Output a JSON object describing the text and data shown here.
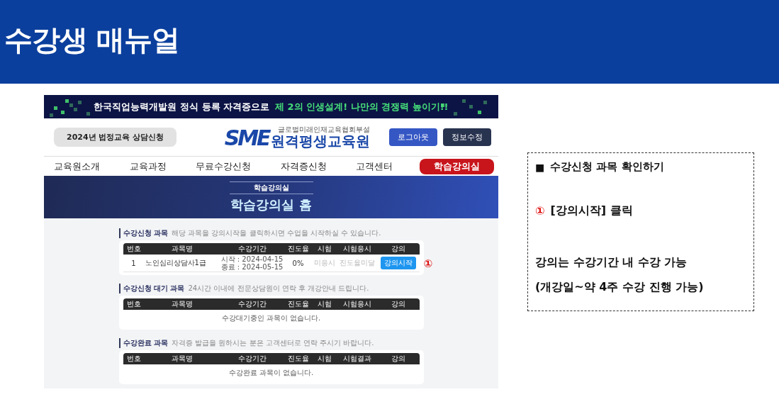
{
  "slide": {
    "title": "수강생 매뉴얼"
  },
  "site": {
    "banner": {
      "text": "한국직업능력개발원 정식 등록 자격증으로",
      "highlight": "제 2의 인생설계! 나만의 경쟁력 높이기!!"
    },
    "consult_button": "2024년 법정교육 상담신청",
    "logo": {
      "mark": "SME",
      "subtitle": "글로벌미래인재교육협회부설",
      "name": "원격평생교육원"
    },
    "header_buttons": [
      {
        "label": "로그아웃",
        "kind": "primary"
      },
      {
        "label": "정보수정",
        "kind": "dark"
      }
    ],
    "nav": [
      {
        "label": "교육원소개",
        "selected": false
      },
      {
        "label": "교육과정",
        "selected": false
      },
      {
        "label": "무료수강신청",
        "selected": false
      },
      {
        "label": "자격증신청",
        "selected": false
      },
      {
        "label": "고객센터",
        "selected": false
      },
      {
        "label": "학습강의실",
        "selected": true
      }
    ],
    "hero": {
      "breadcrumb": "학습강의실",
      "title": "학습강의실 홈"
    },
    "sections": [
      {
        "title": "수강신청 과목",
        "note": "해당 과목을 강의시작을 클릭하시면 수업을 시작하실 수 있습니다.",
        "columns": [
          "번호",
          "과목명",
          "수강기간",
          "진도율",
          "시험",
          "시험응시",
          "강의"
        ],
        "rows": [
          {
            "number": "1",
            "course": "노인심리상담사1급",
            "period": [
              "시작 : 2024-04-15",
              "종료 : 2024-05-15"
            ],
            "progress": "0%",
            "exam": "미응시",
            "exam_status": "진도율미달",
            "action": "강의시작",
            "marker": "①"
          }
        ]
      },
      {
        "title": "수강신청 대기 과목",
        "note": "24시간 이내에 전문상담원이 연락 후 개강안내 드립니다.",
        "columns": [
          "번호",
          "과목명",
          "수강기간",
          "진도율",
          "시험",
          "시험응시",
          "강의"
        ],
        "empty_message": "수강대기중인 과목이 없습니다."
      },
      {
        "title": "수강완료 과목",
        "note": "자격증 발급을 원하시는 분은 고객센터로 연락 주시기 바랍니다.",
        "columns": [
          "번호",
          "과목명",
          "수강기간",
          "진도율",
          "시험",
          "시험결과",
          "강의"
        ],
        "empty_message": "수강완료 과목이 없습니다."
      }
    ]
  },
  "callout": {
    "bullet": "■",
    "heading": "수강신청 과목 확인하기",
    "step_marker": "①",
    "step": "[강의시작] 클릭",
    "notes": [
      "강의는 수강기간 내 수강 가능",
      "(개강일~약 4주 수강 진행 가능)"
    ]
  }
}
